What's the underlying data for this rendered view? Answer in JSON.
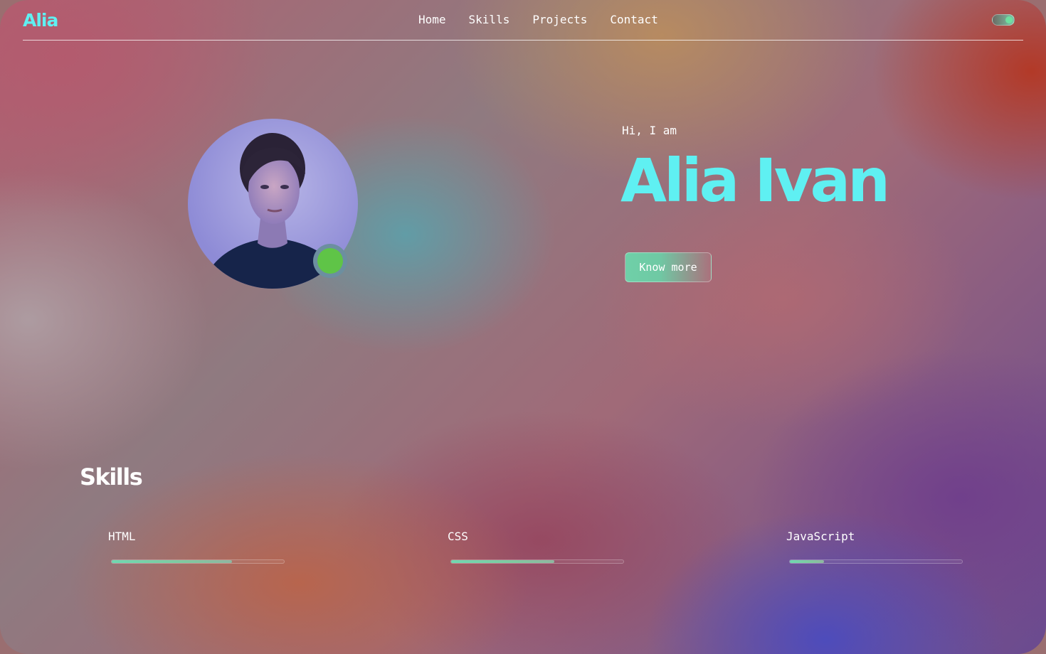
{
  "header": {
    "logo": "Alia",
    "nav": [
      "Home",
      "Skills",
      "Projects",
      "Contact"
    ],
    "theme_toggle": "on"
  },
  "hero": {
    "greeting": "Hi, I am",
    "name": "Alia Ivan",
    "cta_label": "Know more",
    "status": "online"
  },
  "skills": {
    "title": "Skills",
    "items": [
      {
        "name": "HTML",
        "level": 0.7
      },
      {
        "name": "CSS",
        "level": 0.6
      },
      {
        "name": "JavaScript",
        "level": 0.2
      }
    ]
  },
  "colors": {
    "accent": "#5ff0f2",
    "status_green": "#5fc447",
    "skill_fill": "#6fd8b0"
  }
}
